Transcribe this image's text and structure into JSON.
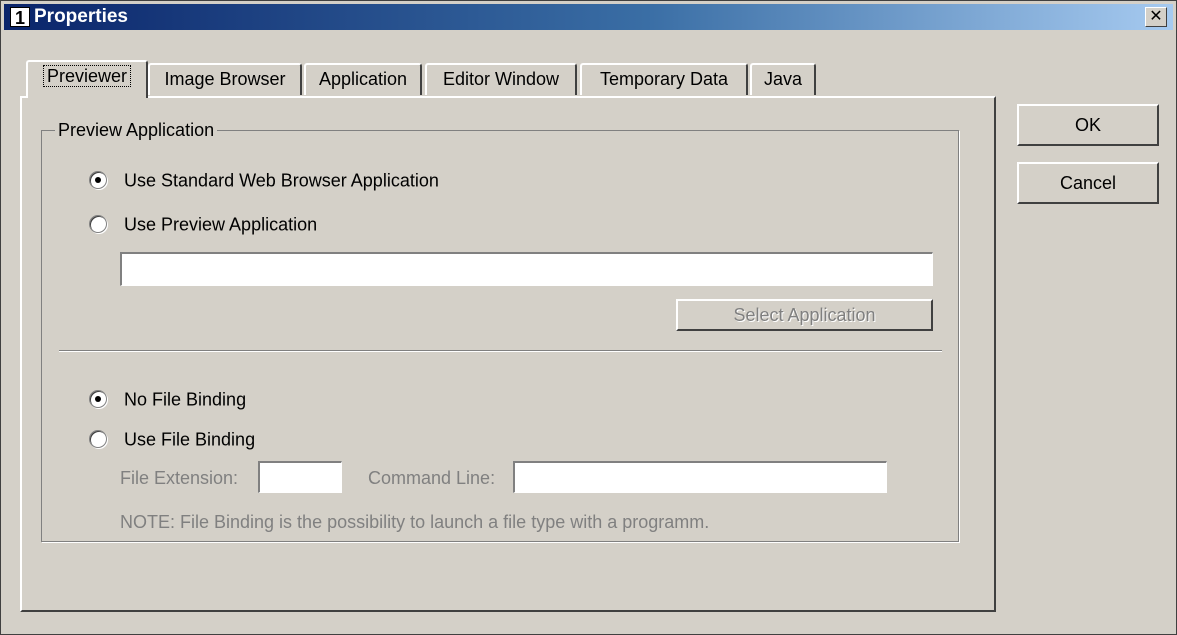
{
  "window": {
    "icon_text": "1",
    "title": "Properties",
    "close_glyph": "✕"
  },
  "tabs": [
    {
      "label": "Previewer",
      "active": true
    },
    {
      "label": "Image Browser",
      "active": false
    },
    {
      "label": "Application",
      "active": false
    },
    {
      "label": "Editor Window",
      "active": false
    },
    {
      "label": "Temporary Data",
      "active": false
    },
    {
      "label": "Java",
      "active": false
    }
  ],
  "preview_group": {
    "label": "Preview Application",
    "options": [
      {
        "label": "Use Standard Web Browser Application",
        "selected": true
      },
      {
        "label": "Use Preview Application",
        "selected": false
      }
    ],
    "app_path_value": "",
    "select_app_label": "Select Application"
  },
  "binding": {
    "options": [
      {
        "label": "No File Binding",
        "selected": true
      },
      {
        "label": "Use File Binding",
        "selected": false
      }
    ],
    "file_ext_label": "File Extension:",
    "file_ext_value": "",
    "cmd_line_label": "Command Line:",
    "cmd_line_value": "",
    "note": "NOTE: File Binding is the possibility to launch a file type with a programm."
  },
  "buttons": {
    "ok": "OK",
    "cancel": "Cancel"
  }
}
